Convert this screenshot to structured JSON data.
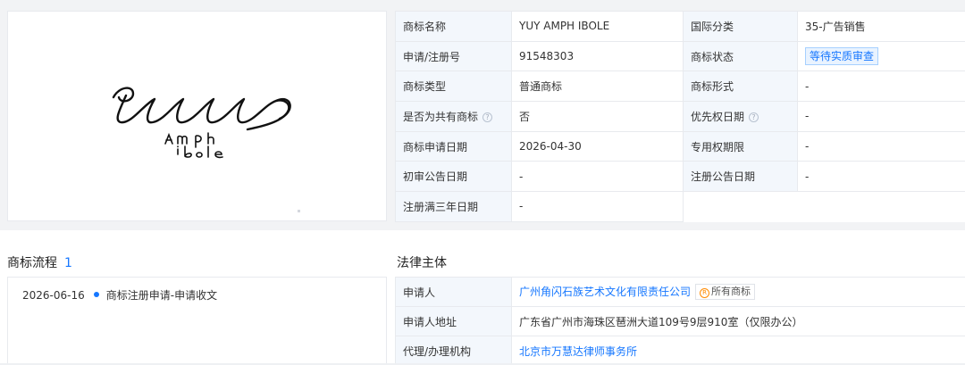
{
  "logo": {
    "text_main": "yeey",
    "text_sub1": "AMPh",
    "text_sub2": "ibole"
  },
  "info": {
    "rows": [
      {
        "l1": "商标名称",
        "v1": "YUY AMPH IBOLE",
        "l2": "国际分类",
        "v2": "35-广告销售"
      },
      {
        "l1": "申请/注册号",
        "v1": "91548303",
        "l2": "商标状态",
        "v2": "等待实质审查"
      },
      {
        "l1": "商标类型",
        "v1": "普通商标",
        "l2": "商标形式",
        "v2": "-"
      },
      {
        "l1": "是否为共有商标",
        "v1": "否",
        "l2": "优先权日期",
        "v2": "-"
      },
      {
        "l1": "商标申请日期",
        "v1": "2026-04-30",
        "l2": "专用权期限",
        "v2": "-"
      },
      {
        "l1": "初审公告日期",
        "v1": "-",
        "l2": "注册公告日期",
        "v2": "-"
      },
      {
        "l1": "注册满三年日期",
        "v1": "-"
      }
    ],
    "help_glyph": "?"
  },
  "flow": {
    "title": "商标流程",
    "count": "1",
    "items": [
      {
        "date": "2026-06-16",
        "text": "商标注册申请-申请收文"
      }
    ]
  },
  "legal": {
    "title": "法律主体",
    "applicant_label": "申请人",
    "applicant": "广州角闪石族艺术文化有限责任公司",
    "all_marks_icon": "R",
    "all_marks": "所有商标",
    "address_label": "申请人地址",
    "address": "广东省广州市海珠区琶洲大道109号9层910室（仅限办公）",
    "agent_label": "代理/办理机构",
    "agent": "北京市万慧达律师事务所"
  },
  "colors": {
    "accent": "#1677ff",
    "label_bg": "#f3f7fc",
    "border": "#e8eaee"
  }
}
